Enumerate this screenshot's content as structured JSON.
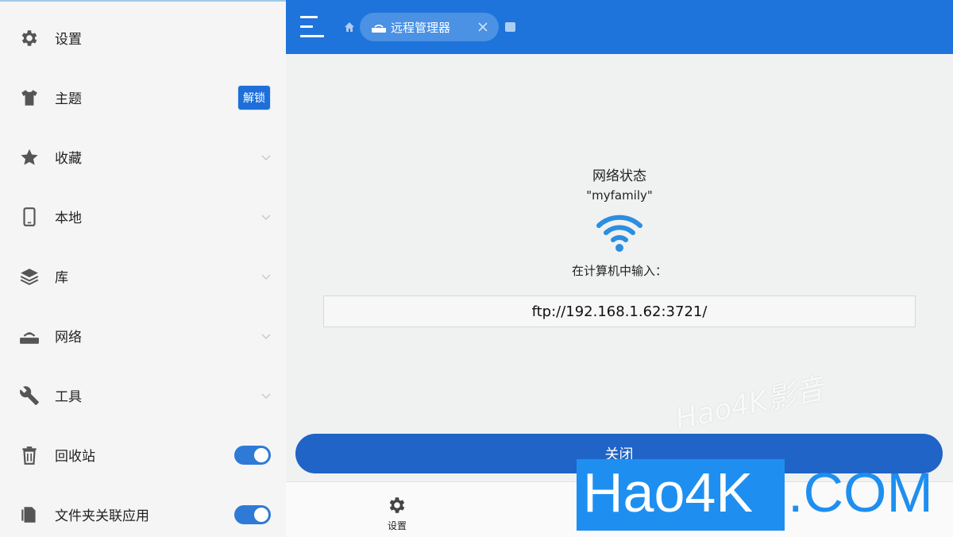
{
  "sidebar": {
    "items": [
      {
        "label": "设置",
        "icon": "gear-icon"
      },
      {
        "label": "主题",
        "icon": "shirt-icon",
        "badge": "解锁"
      },
      {
        "label": "收藏",
        "icon": "star-icon"
      },
      {
        "label": "本地",
        "icon": "phone-icon"
      },
      {
        "label": "库",
        "icon": "layers-icon"
      },
      {
        "label": "网络",
        "icon": "router-icon"
      },
      {
        "label": "工具",
        "icon": "wrench-icon"
      },
      {
        "label": "回收站",
        "icon": "trash-icon",
        "toggle": true
      },
      {
        "label": "文件夹关联应用",
        "icon": "file-icon",
        "toggle": true
      }
    ]
  },
  "header": {
    "tab_label": "远程管理器",
    "accent_color": "#1e74db"
  },
  "main": {
    "status_title": "网络状态",
    "network_name": "\"myfamily\"",
    "prompt": "在计算机中输入：",
    "ftp_address": "ftp://192.168.1.62:3721/",
    "close_label": "关闭"
  },
  "bottom": {
    "settings_label": "设置"
  },
  "watermark": {
    "text": "Hao4K影音",
    "logo_left": "Hao4K",
    "logo_right": ".COM"
  }
}
